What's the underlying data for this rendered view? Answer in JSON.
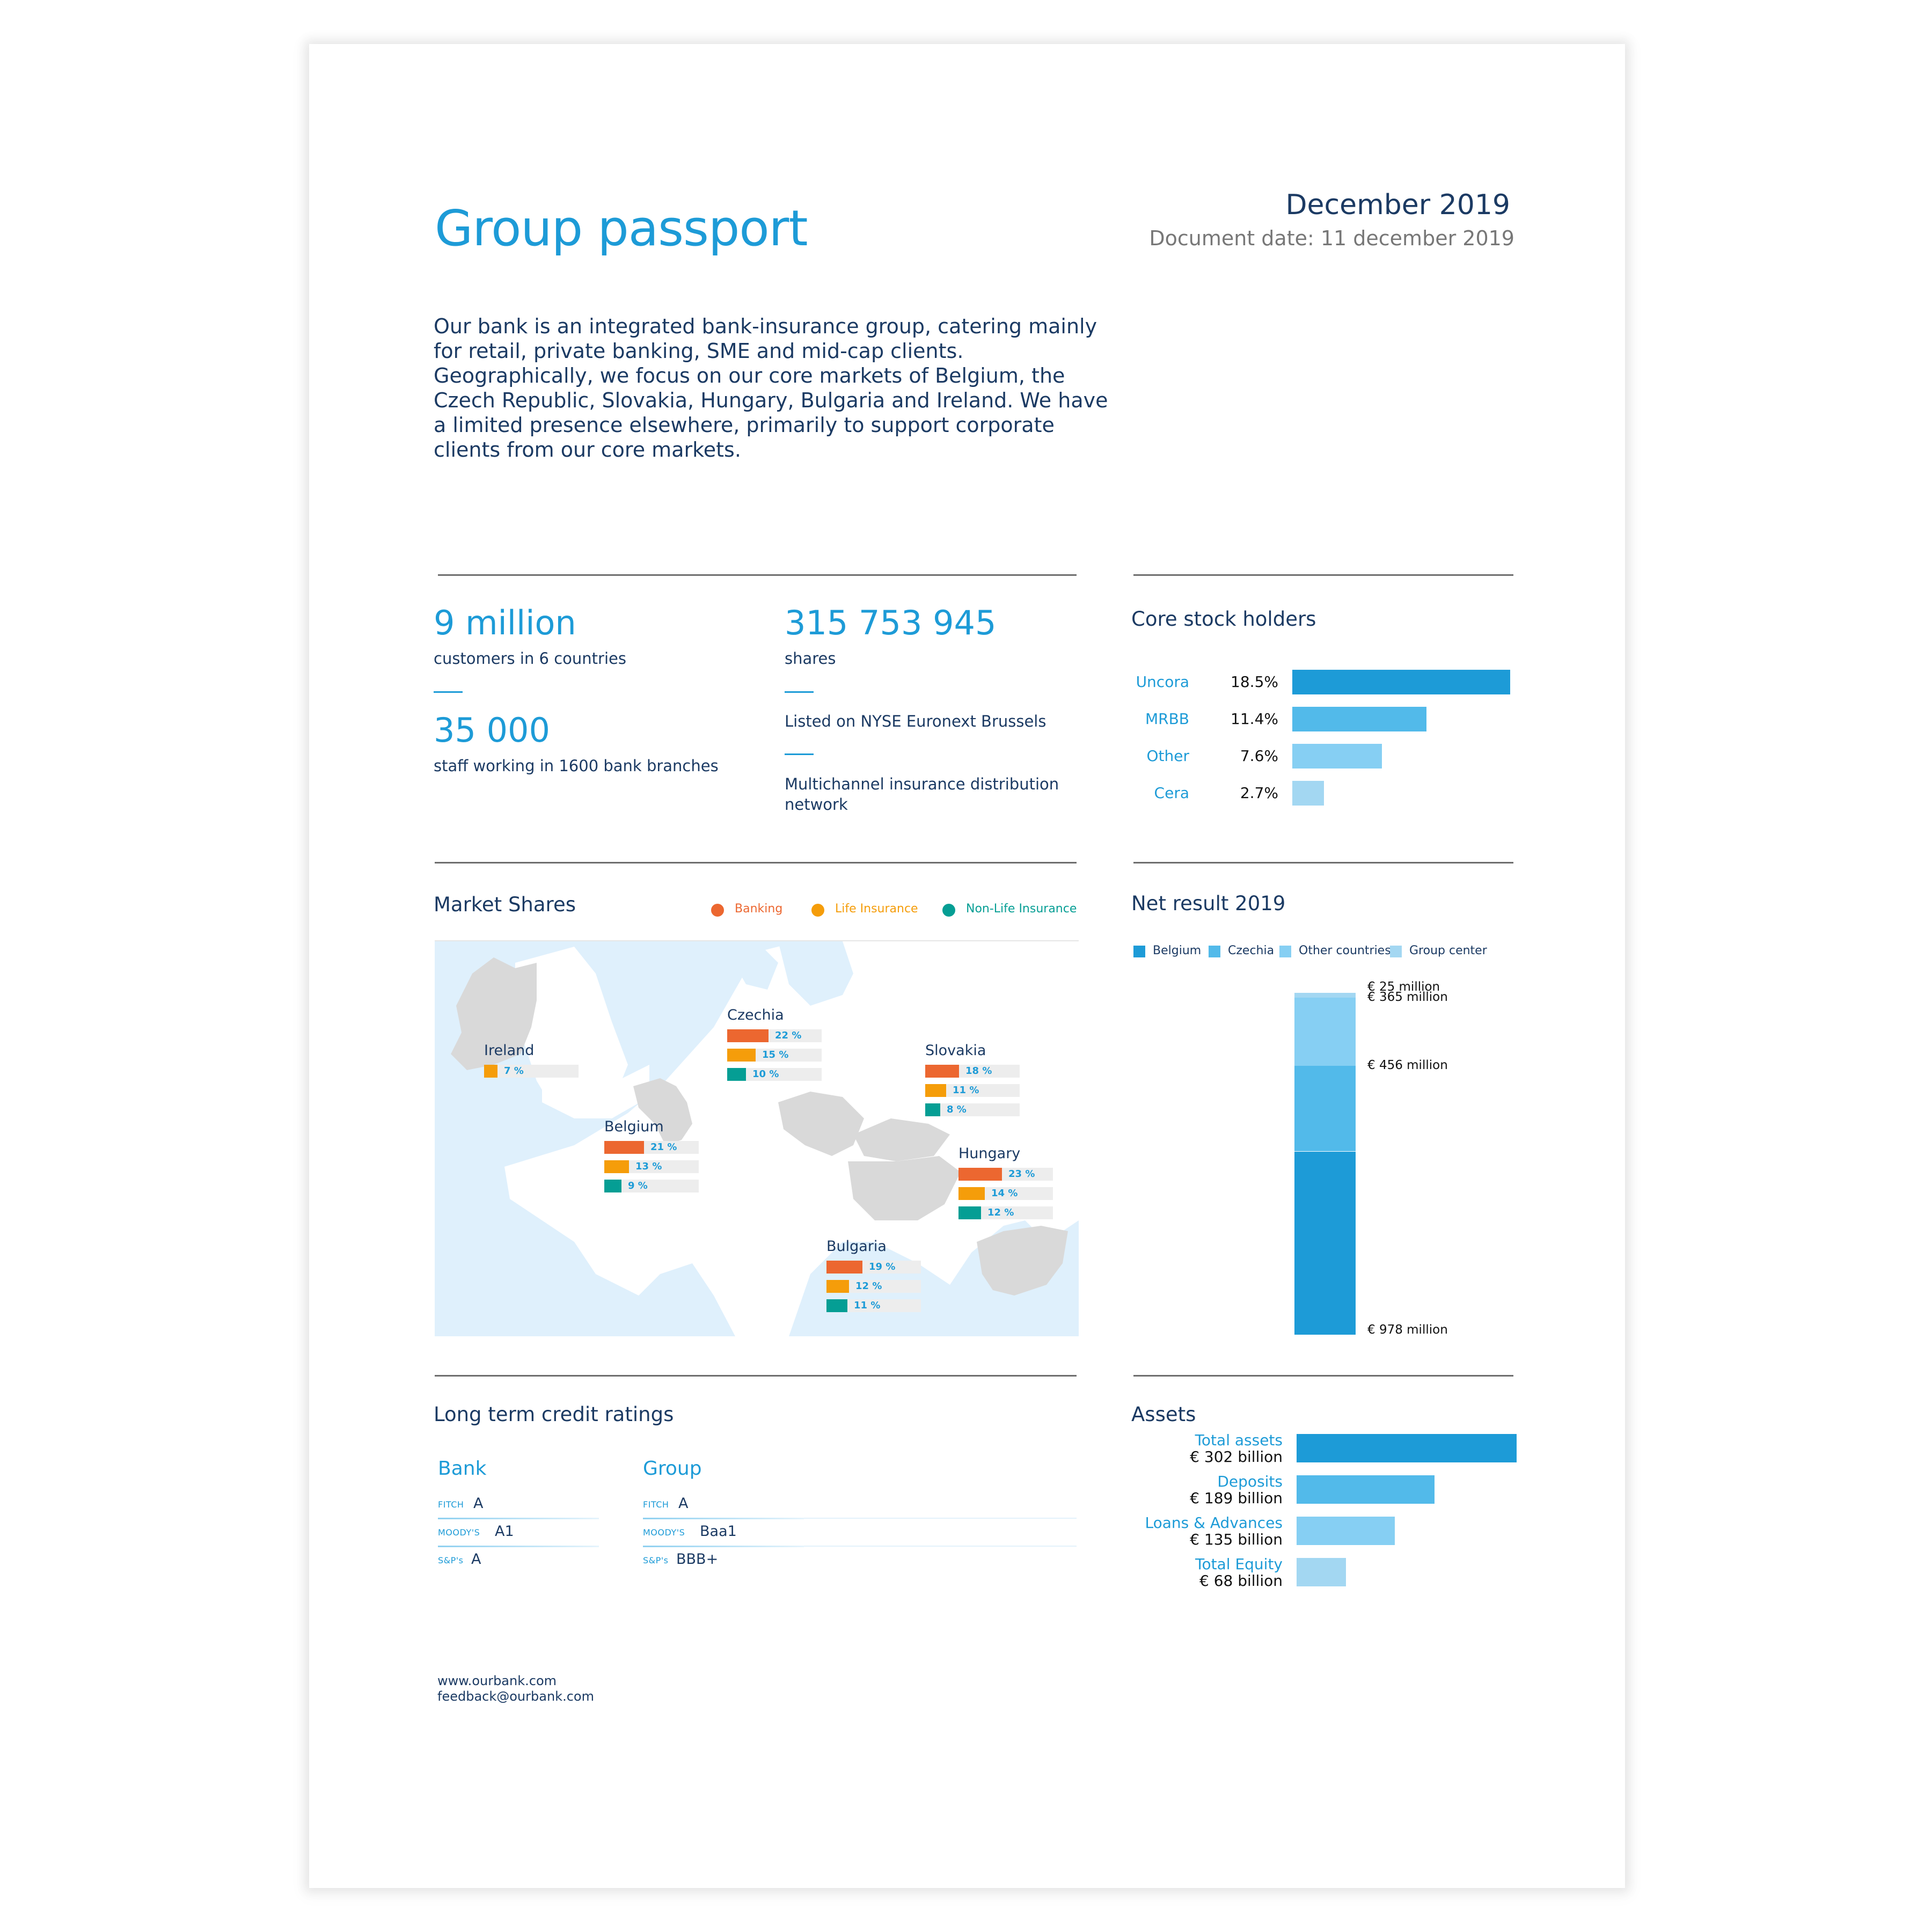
{
  "header": {
    "title": "Group passport",
    "month": "December 2019",
    "document_date": "Document date: 11 december 2019"
  },
  "intro": "Our bank is an integrated bank-insurance group, catering mainly for retail, private banking, SME and mid-cap clients. Geographically, we focus on our core markets of Belgium, the Czech Republic, Slovakia, Hungary, Bulgaria and Ireland. We have a limited presence elsewhere, primarily to support corporate clients from our core markets.",
  "key_figures": {
    "customers": {
      "value": "9 million",
      "caption": "customers in 6 countries"
    },
    "staff": {
      "value": "35 000",
      "caption": "staff working in 1600 bank branches"
    },
    "shares": {
      "value": "315 753 945",
      "caption": "shares"
    },
    "listing": "Listed on NYSE Euronext Brussels",
    "network": "Multichannel insurance distribution network"
  },
  "colors": {
    "accent": "#1d9bd7",
    "text_dark": "#1b3a63",
    "banking": "#ec6730",
    "life_insurance": "#f59d0a",
    "non_life_insurance": "#059e94",
    "blue_1": "#1d9bd7",
    "blue_2": "#52baea",
    "blue_3": "#86cff3",
    "blue_4": "#a3d7f2"
  },
  "chart_data": [
    {
      "type": "bar",
      "title": "Core stock holders",
      "orientation": "horizontal",
      "categories": [
        "Uncora",
        "MRBB",
        "Other",
        "Cera"
      ],
      "values": [
        18.5,
        11.4,
        7.6,
        2.7
      ],
      "labels": [
        "18.5%",
        "11.4%",
        "7.6%",
        "2.7%"
      ],
      "unit": "%"
    },
    {
      "type": "bar",
      "title": "Market Shares",
      "legend": [
        "Banking",
        "Life Insurance",
        "Non-Life Insurance"
      ],
      "legend_position": "top-right",
      "countries": [
        {
          "name": "Ireland",
          "values": [
            {
              "series": "Life Insurance",
              "value": 7,
              "label": "7 %"
            }
          ]
        },
        {
          "name": "Czechia",
          "values": [
            {
              "series": "Banking",
              "value": 22,
              "label": "22 %"
            },
            {
              "series": "Life Insurance",
              "value": 15,
              "label": "15 %"
            },
            {
              "series": "Non-Life Insurance",
              "value": 10,
              "label": "10 %"
            }
          ]
        },
        {
          "name": "Slovakia",
          "values": [
            {
              "series": "Banking",
              "value": 18,
              "label": "18 %"
            },
            {
              "series": "Life Insurance",
              "value": 11,
              "label": "11 %"
            },
            {
              "series": "Non-Life Insurance",
              "value": 8,
              "label": "8 %"
            }
          ]
        },
        {
          "name": "Belgium",
          "values": [
            {
              "series": "Banking",
              "value": 21,
              "label": "21 %"
            },
            {
              "series": "Life Insurance",
              "value": 13,
              "label": "13 %"
            },
            {
              "series": "Non-Life Insurance",
              "value": 9,
              "label": "9 %"
            }
          ]
        },
        {
          "name": "Hungary",
          "values": [
            {
              "series": "Banking",
              "value": 23,
              "label": "23 %"
            },
            {
              "series": "Life Insurance",
              "value": 14,
              "label": "14 %"
            },
            {
              "series": "Non-Life Insurance",
              "value": 12,
              "label": "12 %"
            }
          ]
        },
        {
          "name": "Bulgaria",
          "values": [
            {
              "series": "Banking",
              "value": 19,
              "label": "19 %"
            },
            {
              "series": "Life Insurance",
              "value": 12,
              "label": "12 %"
            },
            {
              "series": "Non-Life Insurance",
              "value": 11,
              "label": "11 %"
            }
          ]
        }
      ],
      "scale_max": 50
    },
    {
      "type": "bar",
      "stacked": true,
      "title": "Net result 2019",
      "legend": [
        "Belgium",
        "Czechia",
        "Other countries",
        "Group center"
      ],
      "legend_position": "top",
      "series": [
        {
          "name": "Belgium",
          "values": [
            978
          ],
          "label": "€ 978 million"
        },
        {
          "name": "Czechia",
          "values": [
            456
          ],
          "label": "€ 456 million"
        },
        {
          "name": "Other countries",
          "values": [
            365
          ],
          "label": "€ 365 million"
        },
        {
          "name": "Group center",
          "values": [
            25
          ],
          "label": "€ 25 million"
        }
      ],
      "unit": "€ million"
    },
    {
      "type": "bar",
      "title": "Assets",
      "orientation": "horizontal",
      "categories": [
        "Total assets",
        "Deposits",
        "Loans & Advances",
        "Total Equity"
      ],
      "values": [
        302,
        189,
        135,
        68
      ],
      "labels": [
        "€ 302 billion",
        "€ 189 billion",
        "€ 135 billion",
        "€ 68 billion"
      ],
      "unit": "€ billion"
    }
  ],
  "credit_ratings": {
    "title": "Long term credit ratings",
    "columns": [
      {
        "heading": "Bank",
        "rows": [
          {
            "agency": "FITCH",
            "rating": "A"
          },
          {
            "agency": "MOODY'S",
            "rating": "A1"
          },
          {
            "agency": "S&P's",
            "rating": "A"
          }
        ]
      },
      {
        "heading": "Group",
        "rows": [
          {
            "agency": "FITCH",
            "rating": "A"
          },
          {
            "agency": "MOODY'S",
            "rating": "Baa1"
          },
          {
            "agency": "S&P's",
            "rating": "BBB+"
          }
        ]
      }
    ]
  },
  "footer": {
    "website": "www.ourbank.com",
    "email": "feedback@ourbank.com"
  }
}
